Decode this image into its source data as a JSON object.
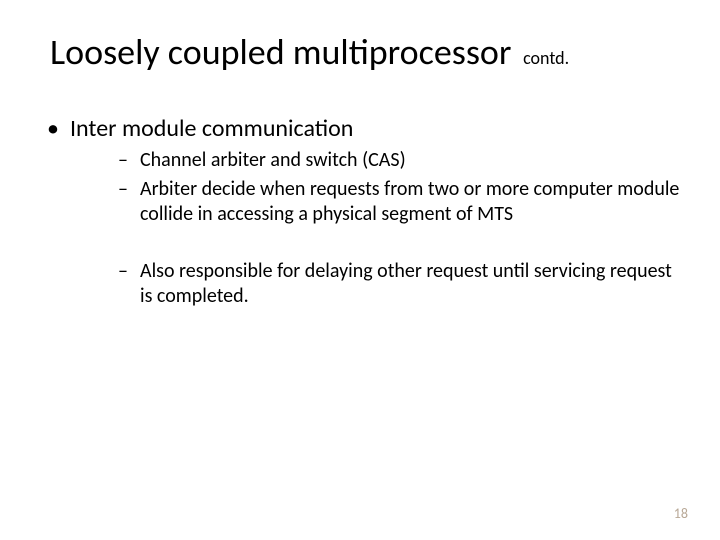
{
  "title": {
    "main": "Loosely coupled multiprocessor",
    "contd": "contd."
  },
  "bullets": {
    "l1_0": "Inter module communication",
    "l2_0": "Channel arbiter and switch (CAS)",
    "l2_1": "Arbiter decide when requests from two or more computer module collide in accessing a physical segment of MTS",
    "l2_2": "Also responsible for delaying other request until servicing request is completed."
  },
  "page_number": "18"
}
